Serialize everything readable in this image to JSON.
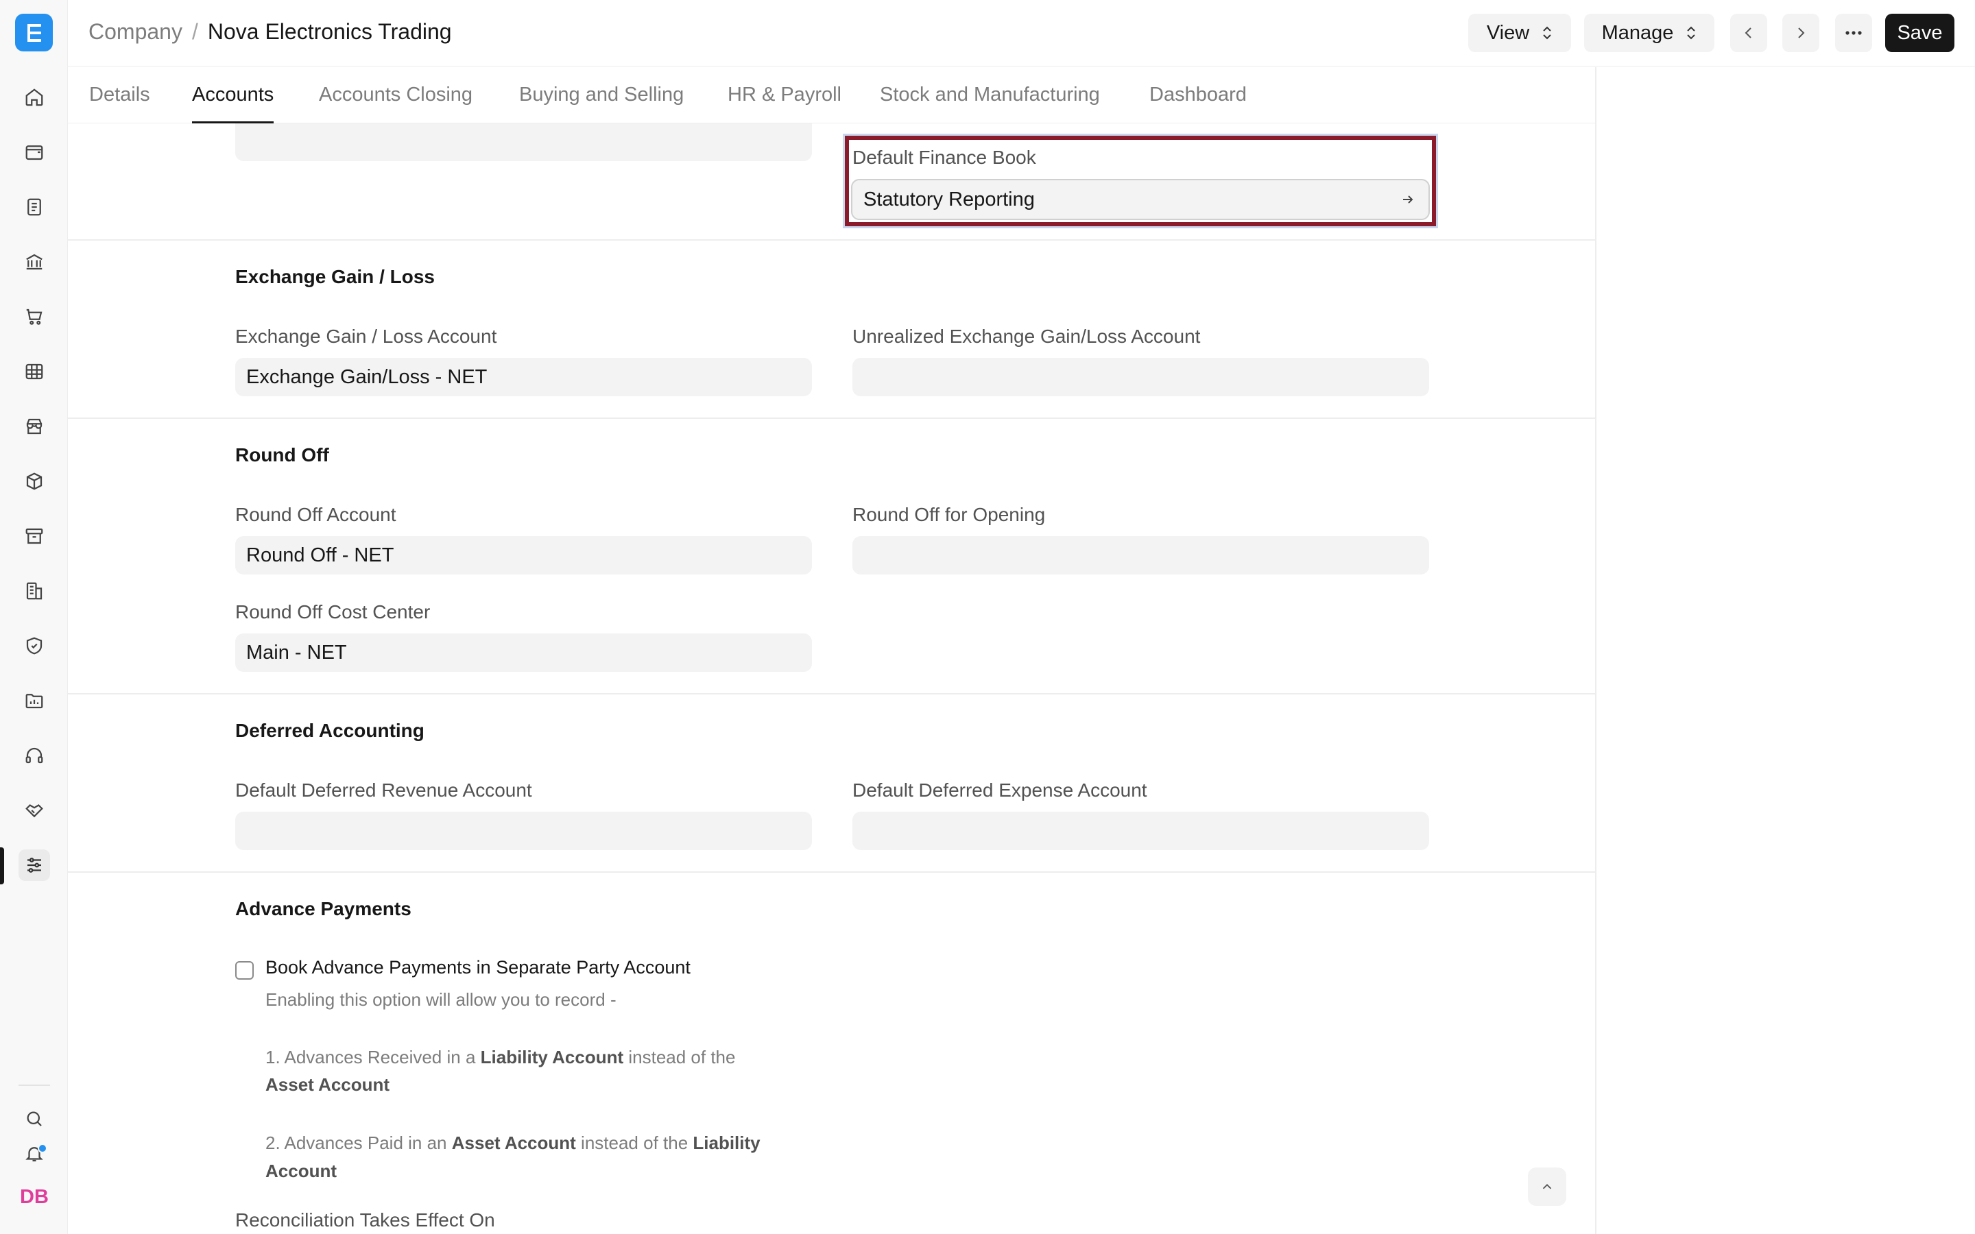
{
  "app": {
    "logo_letter": "E",
    "accent_color": "#2490ef"
  },
  "sidebar": {
    "icons": [
      "home-icon",
      "wallet-icon",
      "document-icon",
      "bank-icon",
      "cart-icon",
      "table-icon",
      "store-icon",
      "box-icon",
      "archive-icon",
      "building-icon",
      "shield-icon",
      "folder-chart-icon",
      "headset-icon",
      "handshake-icon",
      "settings-sliders-icon"
    ],
    "active_item": "settings-sliders-icon",
    "bottom": {
      "search_icon": "search-icon",
      "bell_icon": "bell-icon",
      "avatar_initials": "DB"
    }
  },
  "header": {
    "breadcrumb_parent": "Company",
    "breadcrumb_separator": "/",
    "breadcrumb_current": "Nova Electronics Trading",
    "view_label": "View",
    "manage_label": "Manage",
    "more_label": "···",
    "save_label": "Save"
  },
  "tabs": [
    "Details",
    "Accounts",
    "Accounts Closing",
    "Buying and Selling",
    "HR & Payroll",
    "Stock and Manufacturing",
    "Dashboard"
  ],
  "active_tab": "Accounts",
  "form": {
    "default_finance_book": {
      "label": "Default Finance Book",
      "value": "Statutory Reporting"
    },
    "exchange": {
      "title": "Exchange Gain / Loss",
      "gain_loss_account_label": "Exchange Gain / Loss Account",
      "gain_loss_account_value": "Exchange Gain/Loss - NET",
      "unrealized_label": "Unrealized Exchange Gain/Loss Account",
      "unrealized_value": ""
    },
    "round_off": {
      "title": "Round Off",
      "account_label": "Round Off Account",
      "account_value": "Round Off - NET",
      "opening_label": "Round Off for Opening",
      "opening_value": "",
      "cost_center_label": "Round Off Cost Center",
      "cost_center_value": "Main - NET"
    },
    "deferred": {
      "title": "Deferred Accounting",
      "revenue_label": "Default Deferred Revenue Account",
      "revenue_value": "",
      "expense_label": "Default Deferred Expense Account",
      "expense_value": ""
    },
    "advance": {
      "title": "Advance Payments",
      "checkbox_label": "Book Advance Payments in Separate Party Account",
      "checkbox_checked": false,
      "desc_intro": "Enabling this option will allow you to record -",
      "line1_a": "1. Advances Received in a ",
      "line1_b": "Liability Account",
      "line1_c": " instead of the",
      "line1_d": "Asset Account",
      "line2_a": "2. Advances Paid in an ",
      "line2_b": "Asset Account",
      "line2_c": " instead of the ",
      "line2_d": "Liability",
      "line2_e": "Account",
      "reconciliation_label": "Reconciliation Takes Effect On"
    }
  }
}
